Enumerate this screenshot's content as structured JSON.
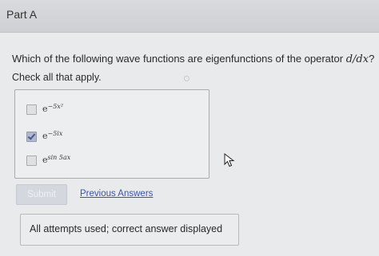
{
  "part": {
    "title": "Part A"
  },
  "question": {
    "text": "Which of the following wave functions are eigenfunctions of the operator",
    "operator": "d/dx",
    "end": "?",
    "instruction": "Check all that apply."
  },
  "choices": [
    {
      "base": "e",
      "exponent": "−5x²",
      "checked": false
    },
    {
      "base": "e",
      "exponent": "−5ix",
      "checked": true
    },
    {
      "base": "e",
      "exponent": "sin 5ax",
      "checked": false
    }
  ],
  "actions": {
    "submit_label": "Submit",
    "previous_answers_label": "Previous Answers"
  },
  "status": {
    "message": "All attempts used; correct answer displayed"
  }
}
